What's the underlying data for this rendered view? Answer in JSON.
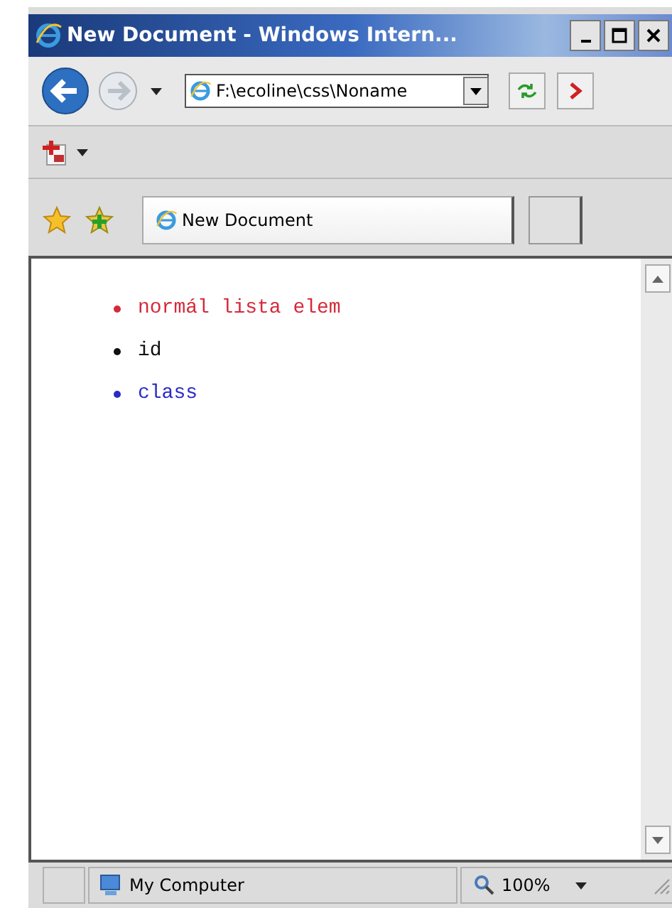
{
  "window": {
    "title": "New Document - Windows Intern..."
  },
  "address_bar": {
    "value": "F:\\ecoline\\css\\Noname"
  },
  "tab": {
    "label": "New Document",
    "selected": true
  },
  "list": [
    {
      "text": "normál lista elem",
      "color": "#d42a3a"
    },
    {
      "text": "id",
      "color": "#111111"
    },
    {
      "text": "class",
      "color": "#2a2ac8"
    }
  ],
  "status_bar": {
    "zone": "My Computer",
    "zoom": "100%"
  }
}
